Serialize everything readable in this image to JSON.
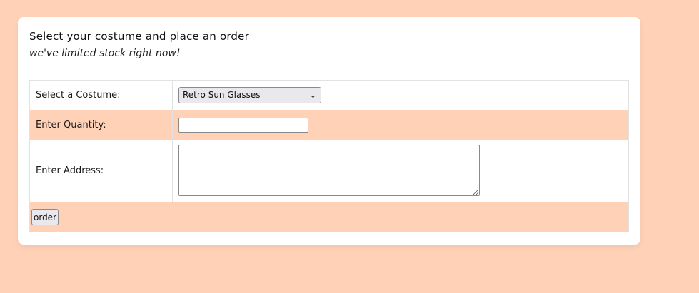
{
  "form": {
    "heading": "Select your costume and place an order",
    "subheading": "we've limited stock right now!",
    "costume_label": "Select a Costume:",
    "costume_selected": "Retro Sun Glasses",
    "quantity_label": "Enter Quantity:",
    "quantity_value": "",
    "address_label": "Enter Address:",
    "address_value": "",
    "submit_label": "order"
  },
  "icons": {
    "select_arrow": "chevron-down-icon"
  },
  "colors": {
    "background": "#ffd2b8",
    "card": "#ffffff",
    "row_alt": "#ffd2b8",
    "control_bg": "#e9e9ed"
  }
}
